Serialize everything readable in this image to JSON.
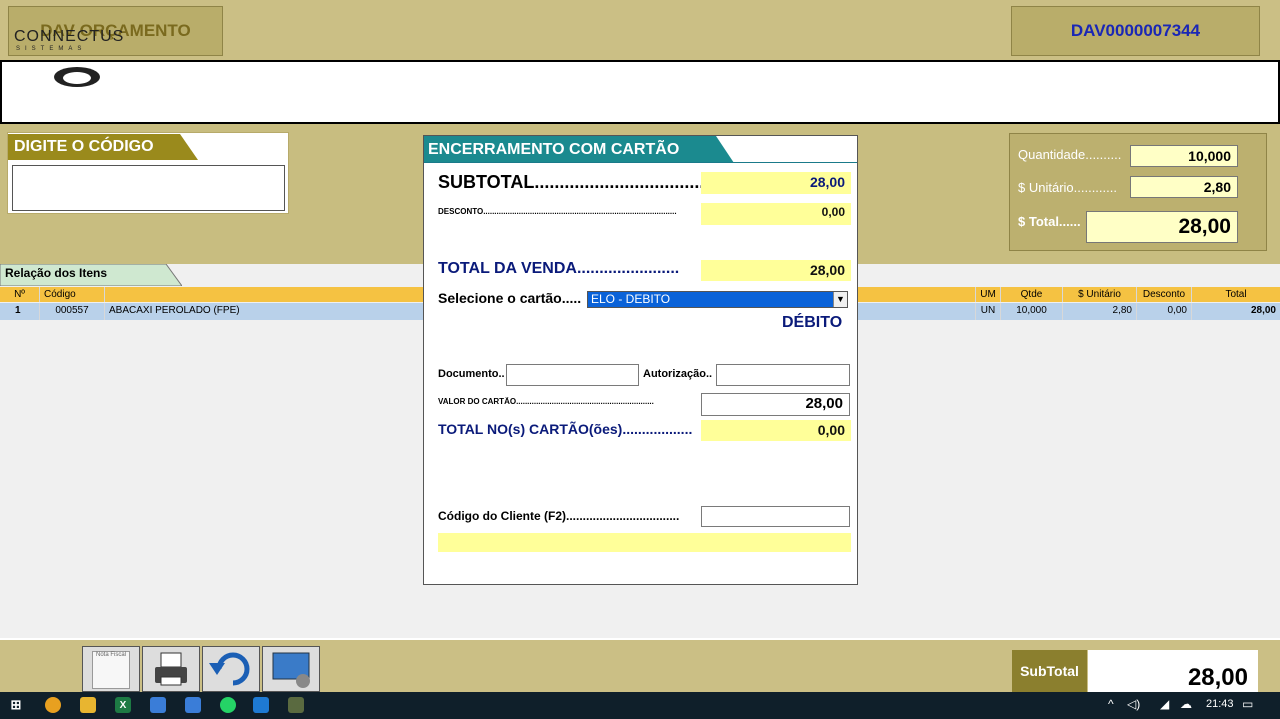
{
  "header": {
    "title": "DAV ORÇAMENTO",
    "dav_number": "DAV0000007344"
  },
  "logo": {
    "name": "CONNECTUS",
    "subtitle": "SISTEMAS"
  },
  "code_panel": {
    "label": "DIGITE O CÓDIGO",
    "value": ""
  },
  "qty_panel": {
    "quantidade_label": "Quantidade..........",
    "quantidade_value": "10,000",
    "unitario_label": "$ Unitário............",
    "unitario_value": "2,80",
    "total_label": "$ Total......",
    "total_value": "28,00"
  },
  "items": {
    "tab_label": "Relação dos Itens",
    "columns": [
      "Nº",
      "Código",
      "",
      "UM",
      "Qtde",
      "$ Unitário",
      "Desconto",
      "Total"
    ],
    "rows": [
      {
        "n": "1",
        "codigo": "000557",
        "descricao": "ABACAXI PEROLADO (FPE)",
        "um": "UN",
        "qtde": "10,000",
        "unitario": "2,80",
        "desconto": "0,00",
        "total": "28,00"
      }
    ]
  },
  "dialog": {
    "title": "ENCERRAMENTO COM CARTÃO",
    "subtotal_label": "SUBTOTAL...................................",
    "subtotal_value": "28,00",
    "desconto_label": "DESCONTO.......................................................................................",
    "desconto_value": "0,00",
    "total_venda_label": "TOTAL DA VENDA.......................",
    "total_venda_value": "28,00",
    "selecione_label": "Selecione o cartão.....",
    "card_selected": "ELO - DEBITO",
    "card_type": "DÉBITO",
    "documento_label": "Documento..",
    "documento_value": "",
    "autorizacao_label": "Autorização..",
    "autorizacao_value": "",
    "valor_cartao_label": "VALOR DO CARTÃO..............................................................",
    "valor_cartao_value": "28,00",
    "total_cartoes_label": "TOTAL NO(s) CARTÃO(ões)..................",
    "total_cartoes_value": "0,00",
    "codigo_cliente_label": "Código do Cliente (F2)..................................",
    "codigo_cliente_value": ""
  },
  "bottom": {
    "subtotal_label": "SubTotal",
    "subtotal_value": "28,00",
    "nota_fiscal_label": "Nota Fiscal"
  },
  "taskbar": {
    "clock": "21:43"
  },
  "colors": {
    "background": "#c8bd80",
    "gold_panel": "#b9ad6a",
    "tab_olive": "#9a8a1c",
    "tab_teal": "#1b8a8f",
    "highlight_yellow": "#ffff99",
    "navy_text": "#0a1a7a",
    "selection_blue": "#0a62d8",
    "header_orange": "#f5c242"
  }
}
